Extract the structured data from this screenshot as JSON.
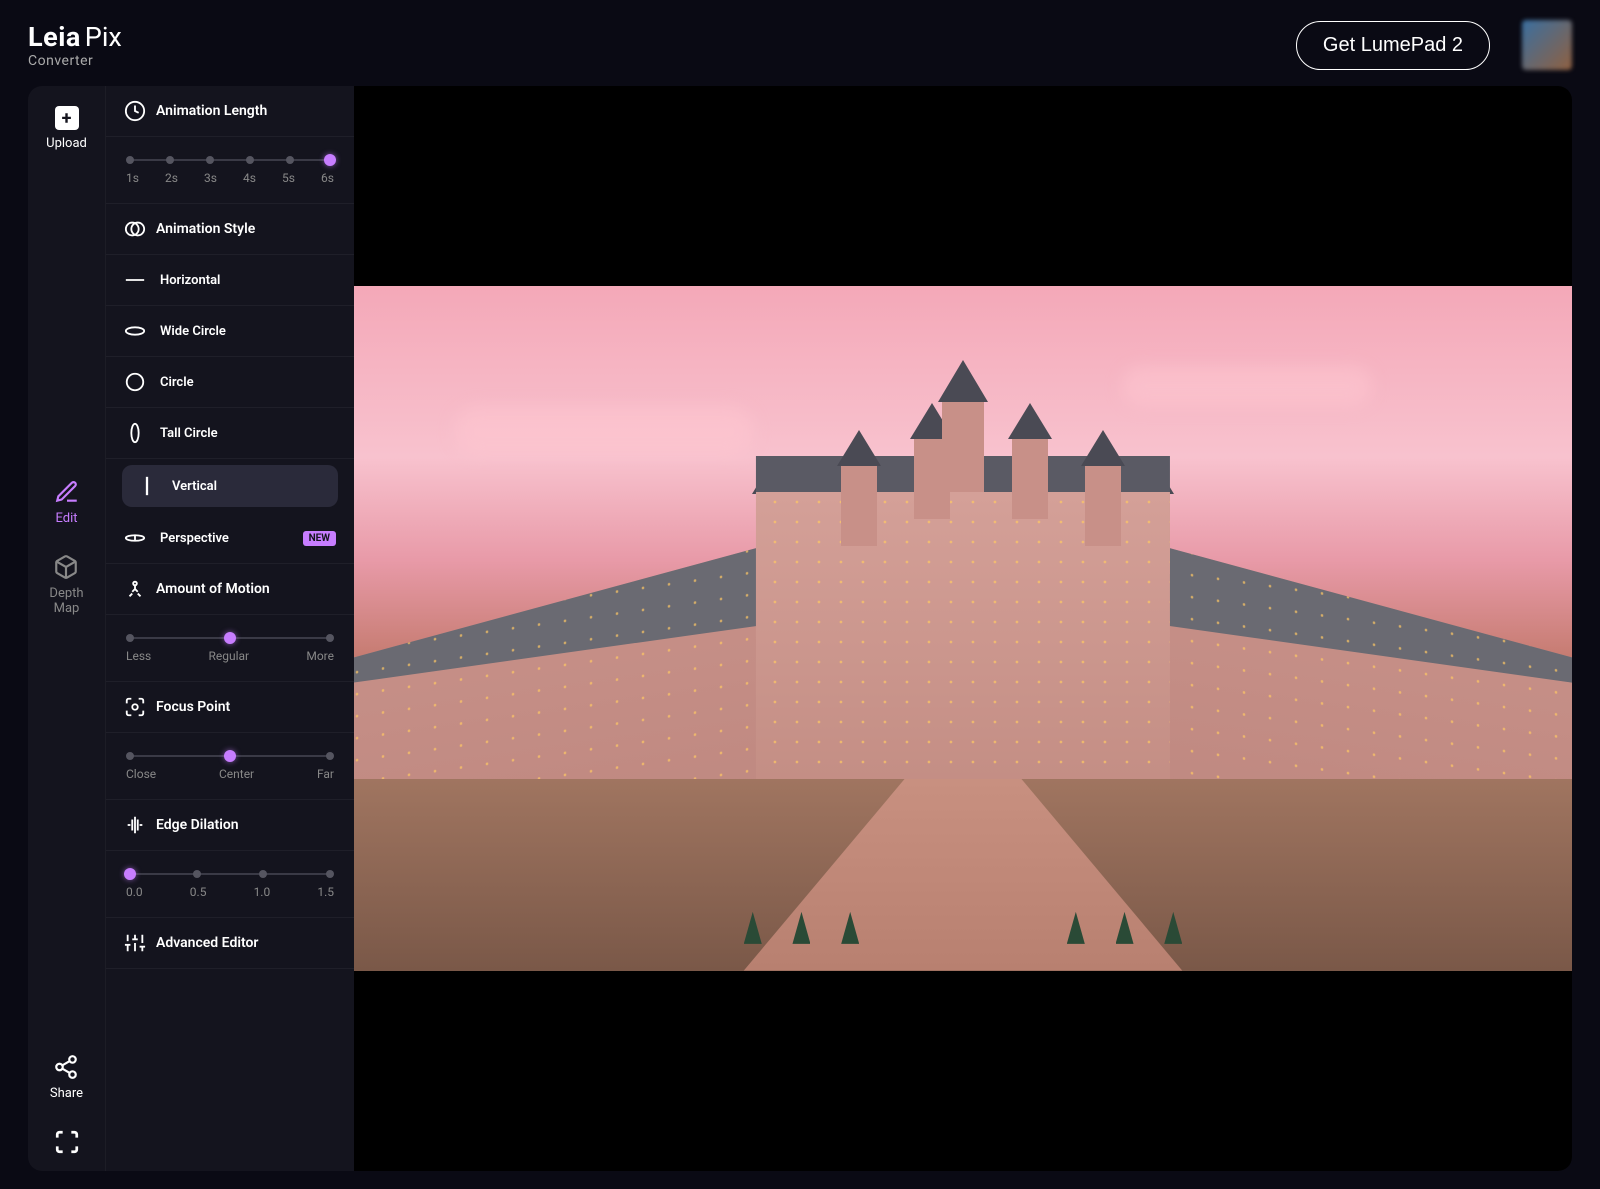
{
  "header": {
    "logo_main": "Leia",
    "logo_suffix": "Pix",
    "logo_sub": "Converter",
    "cta": "Get LumePad 2"
  },
  "nav": {
    "upload": "Upload",
    "edit": "Edit",
    "depthmap_l1": "Depth",
    "depthmap_l2": "Map",
    "share": "Share"
  },
  "panel": {
    "anim_length": {
      "label": "Animation Length",
      "ticks": [
        "1s",
        "2s",
        "3s",
        "4s",
        "5s",
        "6s"
      ],
      "selected_index": 5
    },
    "anim_style": {
      "label": "Animation Style",
      "options": [
        {
          "label": "Horizontal"
        },
        {
          "label": "Wide Circle"
        },
        {
          "label": "Circle"
        },
        {
          "label": "Tall Circle"
        },
        {
          "label": "Vertical",
          "selected": true
        },
        {
          "label": "Perspective",
          "badge": "NEW"
        }
      ]
    },
    "amount_motion": {
      "label": "Amount of Motion",
      "ticks": [
        "Less",
        "Regular",
        "More"
      ],
      "selected_index": 1
    },
    "focus_point": {
      "label": "Focus Point",
      "ticks": [
        "Close",
        "Center",
        "Far"
      ],
      "selected_index": 1
    },
    "edge_dilation": {
      "label": "Edge Dilation",
      "ticks": [
        "0.0",
        "0.5",
        "1.0",
        "1.5"
      ],
      "selected_index": 0
    },
    "advanced": "Advanced Editor"
  }
}
